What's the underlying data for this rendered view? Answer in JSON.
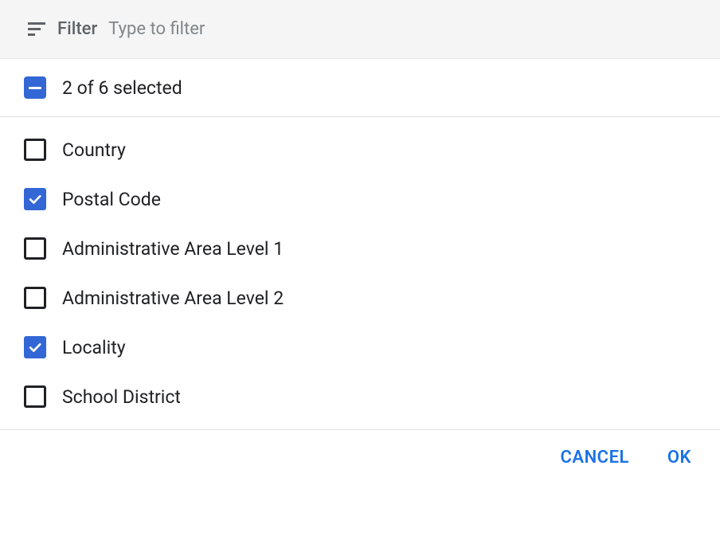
{
  "filter": {
    "label": "Filter",
    "placeholder": "Type to filter"
  },
  "selection": {
    "summary": "2 of 6 selected"
  },
  "options": [
    {
      "label": "Country",
      "checked": false
    },
    {
      "label": "Postal Code",
      "checked": true
    },
    {
      "label": "Administrative Area Level 1",
      "checked": false
    },
    {
      "label": "Administrative Area Level 2",
      "checked": false
    },
    {
      "label": "Locality",
      "checked": true
    },
    {
      "label": "School District",
      "checked": false
    }
  ],
  "buttons": {
    "cancel": "CANCEL",
    "ok": "OK"
  }
}
